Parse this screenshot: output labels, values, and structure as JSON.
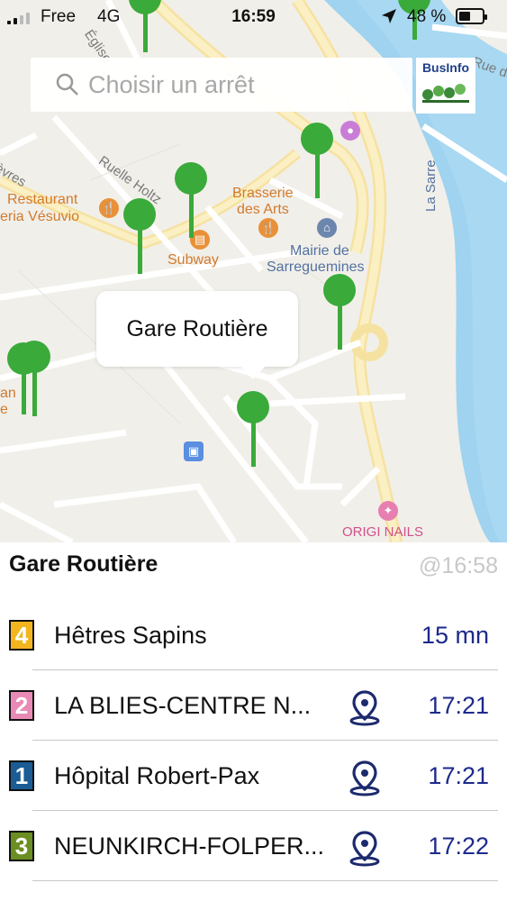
{
  "status_bar": {
    "carrier": "Free",
    "network": "4G",
    "time": "16:59",
    "battery": "48 %",
    "battery_level": 0.48
  },
  "search": {
    "placeholder": "Choisir un arrêt"
  },
  "logo": {
    "name": "BusInfo"
  },
  "map_labels": {
    "restaurant": "Restaurant",
    "vesuvio": "eria Vésuvio",
    "brasserie": "Brasserie",
    "des_arts": "des Arts",
    "subway": "Subway",
    "mairie": "Mairie de",
    "sarreguemines": "Sarreguemines",
    "la_sarre": "La Sarre",
    "ruelle_holtz": "Ruelle Holtz",
    "eglise": "Église",
    "rue_de": "Rue de",
    "evres": "èvres",
    "an": "an",
    "e": "e",
    "origi_nails": "ORIGI NAILS"
  },
  "callout": {
    "label": "Gare Routière"
  },
  "panel": {
    "title": "Gare Routière",
    "updated": "@16:58",
    "departures": [
      {
        "line": "4",
        "color": "#f2b51f",
        "destination": "Hêtres Sapins",
        "time": "15 mn",
        "has_pin": false
      },
      {
        "line": "2",
        "color": "#e98ab6",
        "destination": "LA BLIES-CENTRE N...",
        "time": "17:21",
        "has_pin": true
      },
      {
        "line": "1",
        "color": "#1a5c93",
        "destination": "Hôpital Robert-Pax",
        "time": "17:21",
        "has_pin": true
      },
      {
        "line": "3",
        "color": "#6b8e23",
        "destination": "NEUNKIRCH-FOLPER...",
        "time": "17:22",
        "has_pin": true
      }
    ]
  }
}
